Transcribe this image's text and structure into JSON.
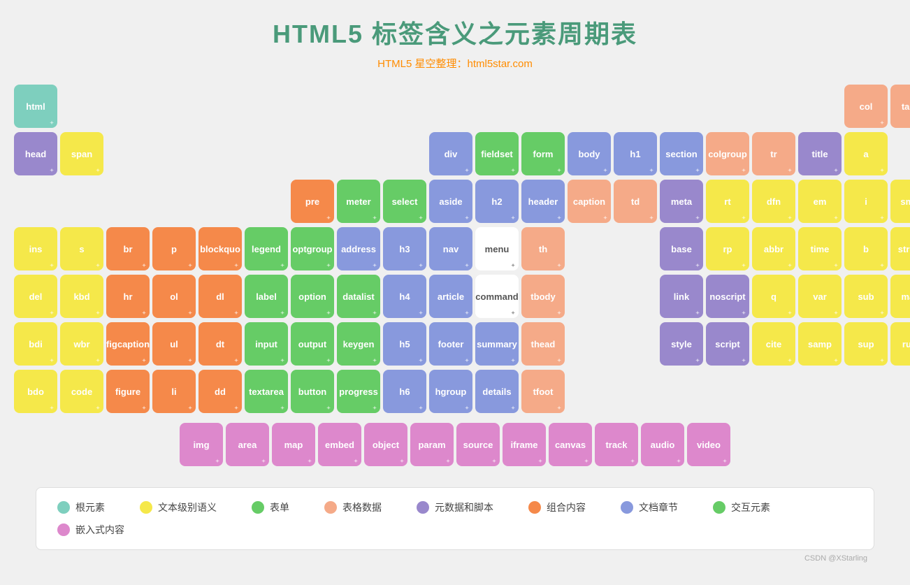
{
  "title": "HTML5 标签含义之元素周期表",
  "subtitle": "HTML5 星空整理：html5star.com",
  "watermark": "CSDN @XStarling",
  "colors": {
    "root": "#7ecfbe",
    "text": "#f5e84a",
    "combo": "#f5894a",
    "doc": "#8899dd",
    "form": "#66cc66",
    "table": "#f5aa88",
    "embed": "#dd88cc",
    "meta": "#9988cc",
    "white": "#ffffff"
  },
  "legend": [
    {
      "label": "根元素",
      "color": "#7ecfbe"
    },
    {
      "label": "文本级别语义",
      "color": "#f5e84a"
    },
    {
      "label": "表单",
      "color": "#66cc66"
    },
    {
      "label": "表格数据",
      "color": "#f5aa88"
    },
    {
      "label": "元数据和脚本",
      "color": "#9988cc"
    },
    {
      "label": "组合内容",
      "color": "#f5894a"
    },
    {
      "label": "文档章节",
      "color": "#8899dd"
    },
    {
      "label": "交互元素",
      "color": "#66cc66"
    },
    {
      "label": "嵌入式内容",
      "color": "#dd88cc"
    }
  ],
  "embed_row": [
    "img",
    "area",
    "map",
    "embed",
    "object",
    "param",
    "source",
    "iframe",
    "canvas",
    "track",
    "audio",
    "video"
  ]
}
